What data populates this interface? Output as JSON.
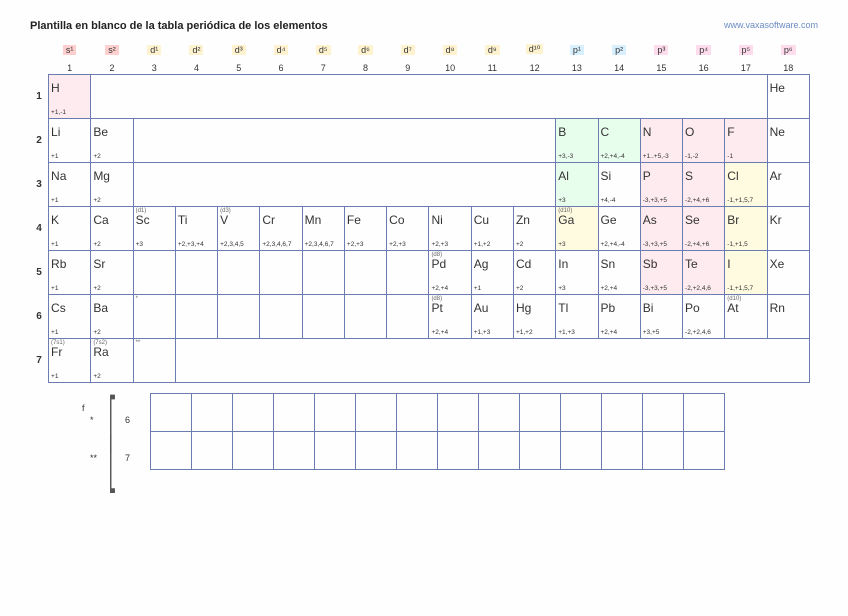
{
  "title": "Plantilla en blanco de la tabla periódica de los elementos",
  "source": "www.vaxasoftware.com",
  "orbitals": [
    "s¹",
    "s²",
    "d¹",
    "d²",
    "d³",
    "d⁴",
    "d⁵",
    "d⁶",
    "d⁷",
    "d⁸",
    "d⁹",
    "d¹⁰",
    "p¹",
    "p²",
    "p³",
    "p⁴",
    "p⁵",
    "p⁶"
  ],
  "groups": [
    "1",
    "2",
    "3",
    "4",
    "5",
    "6",
    "7",
    "8",
    "9",
    "10",
    "11",
    "12",
    "13",
    "14",
    "15",
    "16",
    "17",
    "18"
  ],
  "periods": [
    "1",
    "2",
    "3",
    "4",
    "5",
    "6",
    "7"
  ],
  "fblock_labels": {
    "star": "*",
    "p6": "6",
    "dstar": "**",
    "p7": "7",
    "flabel": "f"
  },
  "cells": {
    "r1": {
      "c1": {
        "sym": "H",
        "ox": "+1,-1"
      },
      "c18": {
        "sym": "He"
      }
    },
    "r2": {
      "c1": {
        "sym": "Li",
        "ox": "+1"
      },
      "c2": {
        "sym": "Be",
        "ox": "+2"
      },
      "c13": {
        "sym": "B",
        "ox": "+3,-3"
      },
      "c14": {
        "sym": "C",
        "ox": "+2,+4,-4"
      },
      "c15": {
        "sym": "N",
        "ox": "+1..+5,-3"
      },
      "c16": {
        "sym": "O",
        "ox": "-1,-2"
      },
      "c17": {
        "sym": "F",
        "ox": "-1"
      },
      "c18": {
        "sym": "Ne"
      }
    },
    "r3": {
      "c1": {
        "sym": "Na",
        "ox": "+1"
      },
      "c2": {
        "sym": "Mg",
        "ox": "+2"
      },
      "c13": {
        "sym": "Al",
        "ox": "+3"
      },
      "c14": {
        "sym": "Si",
        "ox": "+4,-4"
      },
      "c15": {
        "sym": "P",
        "ox": "-3,+3,+5"
      },
      "c16": {
        "sym": "S",
        "ox": "-2,+4,+6"
      },
      "c17": {
        "sym": "Cl",
        "ox": "-1,+1,5,7"
      },
      "c18": {
        "sym": "Ar"
      }
    },
    "r4": {
      "c1": {
        "sym": "K",
        "ox": "+1"
      },
      "c2": {
        "sym": "Ca",
        "ox": "+2"
      },
      "c3": {
        "sym": "Sc",
        "ox": "+3",
        "note": "(d1)"
      },
      "c4": {
        "sym": "Ti",
        "ox": "+2,+3,+4"
      },
      "c5": {
        "sym": "V",
        "ox": "+2,3,4,5",
        "note": "(d3)"
      },
      "c6": {
        "sym": "Cr",
        "ox": "+2,3,4,6,7"
      },
      "c7": {
        "sym": "Mn",
        "ox": "+2,3,4,6,7"
      },
      "c8": {
        "sym": "Fe",
        "ox": "+2,+3"
      },
      "c9": {
        "sym": "Co",
        "ox": "+2,+3"
      },
      "c10": {
        "sym": "Ni",
        "ox": "+2,+3"
      },
      "c11": {
        "sym": "Cu",
        "ox": "+1,+2"
      },
      "c12": {
        "sym": "Zn",
        "ox": "+2"
      },
      "c13": {
        "sym": "Ga",
        "ox": "+3",
        "note": "(d10)"
      },
      "c14": {
        "sym": "Ge",
        "ox": "+2,+4,-4"
      },
      "c15": {
        "sym": "As",
        "ox": "-3,+3,+5"
      },
      "c16": {
        "sym": "Se",
        "ox": "-2,+4,+6"
      },
      "c17": {
        "sym": "Br",
        "ox": "-1,+1,5"
      },
      "c18": {
        "sym": "Kr"
      }
    },
    "r5": {
      "c1": {
        "sym": "Rb",
        "ox": "+1"
      },
      "c2": {
        "sym": "Sr",
        "ox": "+2"
      },
      "c10": {
        "sym": "Pd",
        "ox": "+2,+4",
        "note": "(d8)"
      },
      "c11": {
        "sym": "Ag",
        "ox": "+1"
      },
      "c12": {
        "sym": "Cd",
        "ox": "+2"
      },
      "c13": {
        "sym": "In",
        "ox": "+3"
      },
      "c14": {
        "sym": "Sn",
        "ox": "+2,+4"
      },
      "c15": {
        "sym": "Sb",
        "ox": "-3,+3,+5"
      },
      "c16": {
        "sym": "Te",
        "ox": "-2,+2,4,6"
      },
      "c17": {
        "sym": "I",
        "ox": "-1,+1,5,7"
      },
      "c18": {
        "sym": "Xe"
      }
    },
    "r6": {
      "c1": {
        "sym": "Cs",
        "ox": "+1"
      },
      "c2": {
        "sym": "Ba",
        "ox": "+2"
      },
      "c3": {
        "note": "*"
      },
      "c10": {
        "sym": "Pt",
        "ox": "+2,+4",
        "note": "(d8)"
      },
      "c11": {
        "sym": "Au",
        "ox": "+1,+3"
      },
      "c12": {
        "sym": "Hg",
        "ox": "+1,+2"
      },
      "c13": {
        "sym": "Tl",
        "ox": "+1,+3"
      },
      "c14": {
        "sym": "Pb",
        "ox": "+2,+4"
      },
      "c15": {
        "sym": "Bi",
        "ox": "+3,+5"
      },
      "c16": {
        "sym": "Po",
        "ox": "-2,+2,4,6"
      },
      "c17": {
        "sym": "At",
        "ox": "",
        "note": "(d10)"
      },
      "c18": {
        "sym": "Rn"
      }
    },
    "r7": {
      "c1": {
        "sym": "Fr",
        "ox": "+1",
        "note": "(7s1)"
      },
      "c2": {
        "sym": "Ra",
        "ox": "+2",
        "note": "(7s2)"
      },
      "c3": {
        "note": "**"
      }
    }
  }
}
